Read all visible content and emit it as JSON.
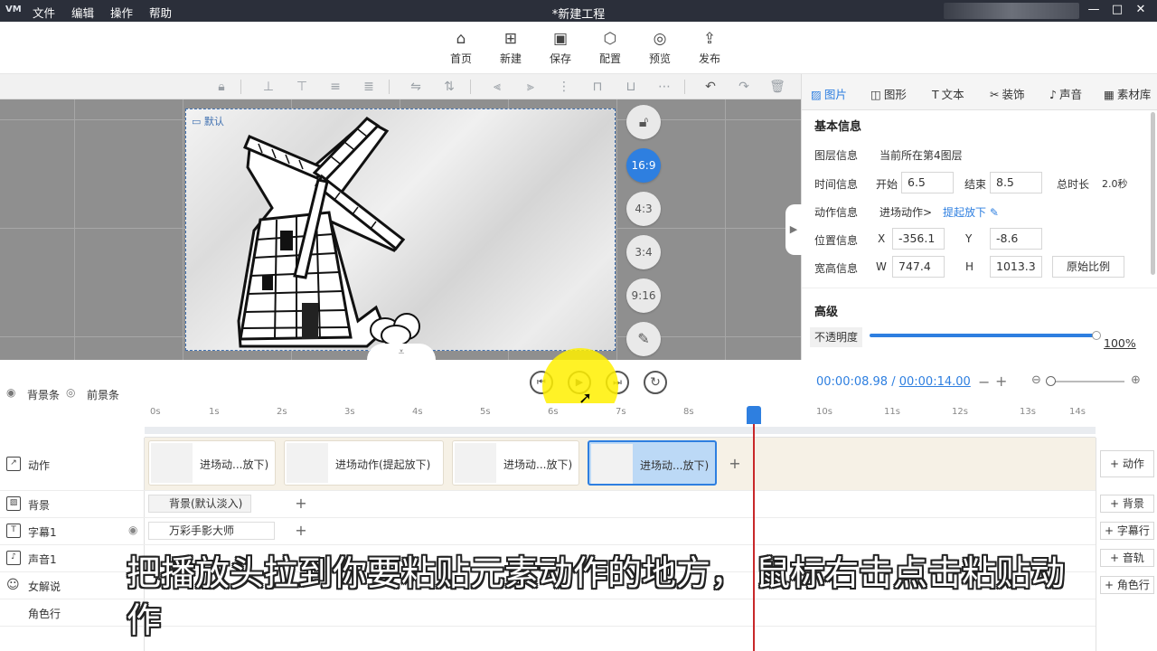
{
  "titlebar": {
    "logo": "VM",
    "menu": [
      "文件",
      "编辑",
      "操作",
      "帮助"
    ],
    "title": "*新建工程",
    "window_buttons": [
      "—",
      "□",
      "✕"
    ]
  },
  "main_toolbar": [
    {
      "label": "首页",
      "icon": "home-icon"
    },
    {
      "label": "新建",
      "icon": "new-icon"
    },
    {
      "label": "保存",
      "icon": "save-icon"
    },
    {
      "label": "配置",
      "icon": "config-icon"
    },
    {
      "label": "预览",
      "icon": "preview-icon"
    },
    {
      "label": "发布",
      "icon": "publish-icon"
    }
  ],
  "canvas": {
    "scene_tag": "默认",
    "ratios": [
      "16:9",
      "4:3",
      "3:4",
      "9:16"
    ],
    "active_ratio": "16:9"
  },
  "right_panel": {
    "tabs": [
      {
        "label": "图片",
        "icon": "image-icon"
      },
      {
        "label": "图形",
        "icon": "shape-icon"
      },
      {
        "label": "文本",
        "icon": "text-icon"
      },
      {
        "label": "装饰",
        "icon": "decor-icon"
      },
      {
        "label": "声音",
        "icon": "sound-icon"
      },
      {
        "label": "素材库",
        "icon": "library-icon"
      }
    ],
    "active_tab": "图片",
    "basic_title": "基本信息",
    "layer_label": "图层信息",
    "layer_value": "当前所在第4图层",
    "time_label": "时间信息",
    "start_label": "开始",
    "start_value": "6.5",
    "end_label": "结束",
    "end_value": "8.5",
    "duration_label": "总时长",
    "duration_value": "2.0秒",
    "action_label": "动作信息",
    "action_prefix": "进场动作>",
    "action_value": "提起放下",
    "pos_label": "位置信息",
    "x_label": "X",
    "x_value": "-356.1",
    "y_label": "Y",
    "y_value": "-8.6",
    "size_label": "宽高信息",
    "w_label": "W",
    "w_value": "747.4",
    "h_label": "H",
    "h_value": "1013.3",
    "ratio_button": "原始比例",
    "advanced_title": "高级",
    "opacity_label": "不透明度",
    "opacity_value": "100%",
    "opacity_fraction": 1.0
  },
  "playback": {
    "current_time": "00:00:08.98",
    "separator": "/",
    "total_time": "00:00:14.00"
  },
  "timeline": {
    "bg_toggle": "背景条",
    "fg_toggle": "前景条",
    "ticks": [
      "0s",
      "1s",
      "2s",
      "3s",
      "4s",
      "5s",
      "6s",
      "7s",
      "8s",
      "9s",
      "10s",
      "11s",
      "12s",
      "13s",
      "14s"
    ],
    "tracks": [
      {
        "label": "动作",
        "icon": "action-icon",
        "add": "动作"
      },
      {
        "label": "背景",
        "icon": "background-icon",
        "add": "背景"
      },
      {
        "label": "字幕1",
        "icon": "subtitle-icon",
        "add": "字幕行"
      },
      {
        "label": "声音1",
        "icon": "audio-icon",
        "add": "音轨"
      },
      {
        "label": "女解说",
        "icon": "narrator-icon",
        "add": "角色行"
      },
      {
        "label": "角色行",
        "icon": "",
        "add": ""
      }
    ],
    "action_clips": [
      {
        "text": "进场动...放下)"
      },
      {
        "text": "进场动作(提起放下)"
      },
      {
        "text": "进场动...放下)"
      },
      {
        "text": "进场动...放下)"
      }
    ],
    "background_clip": "背景(默认淡入)",
    "subtitle_clip": "万彩手影大师"
  },
  "subtitle_overlay": "把播放头拉到你要粘贴元素动作的地方， 鼠标右击点击粘贴动作"
}
